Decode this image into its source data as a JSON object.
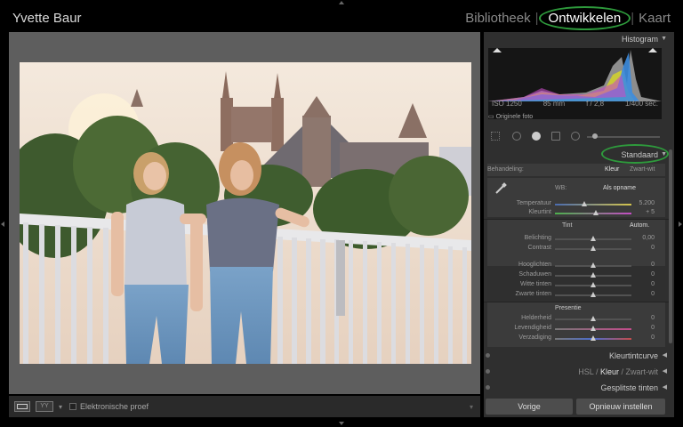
{
  "app": {
    "identity": "Yvette Baur",
    "modules": [
      "Bibliotheek",
      "Ontwikkelen",
      "Kaart"
    ],
    "active_module": "Ontwikkelen",
    "module_separator": "|"
  },
  "toolbar": {
    "softproof_label": "Elektronische proef",
    "yy_label": "YY"
  },
  "histogram": {
    "title": "Histogram",
    "iso": "ISO 1250",
    "focal": "85 mm",
    "aperture": "f / 2,8",
    "shutter": "1/400 sec.",
    "original_label": "Originele foto"
  },
  "basic": {
    "preset": "Standaard",
    "treatment_label": "Behandeling:",
    "treatment_color": "Kleur",
    "treatment_bw": "Zwart-wit",
    "wb_label": "WB:",
    "wb_value": "Als opname",
    "tint_title": "Tint",
    "tint_auto": "Autom.",
    "presence_title": "Presentie",
    "sliders": {
      "temperature": {
        "label": "Temperatuur",
        "value": "5.200",
        "pos": 0.38
      },
      "tint": {
        "label": "Kleurtint",
        "value": "+ 5",
        "pos": 0.53
      },
      "exposure": {
        "label": "Belichting",
        "value": "0,00",
        "pos": 0.5
      },
      "contrast": {
        "label": "Contrast",
        "value": "0",
        "pos": 0.5
      },
      "highlights": {
        "label": "Hooglichten",
        "value": "0",
        "pos": 0.5
      },
      "shadows": {
        "label": "Schaduwen",
        "value": "0",
        "pos": 0.5
      },
      "whites": {
        "label": "Witte tinten",
        "value": "0",
        "pos": 0.5
      },
      "blacks": {
        "label": "Zwarte tinten",
        "value": "0",
        "pos": 0.5
      },
      "clarity": {
        "label": "Helderheid",
        "value": "0",
        "pos": 0.5
      },
      "vibrance": {
        "label": "Levendigheid",
        "value": "0",
        "pos": 0.5
      },
      "saturation": {
        "label": "Verzadiging",
        "value": "0",
        "pos": 0.5
      }
    }
  },
  "sections": {
    "tone_curve": "Kleurtintcurve",
    "hsl": "HSL",
    "color": "Kleur",
    "bw": "Zwart-wit",
    "split": "Gesplitste tinten"
  },
  "buttons": {
    "previous": "Vorige",
    "reset": "Opnieuw instellen"
  },
  "colors": {
    "accent_green": "#2e9a3c",
    "panel_bg": "#2f2f2f"
  }
}
